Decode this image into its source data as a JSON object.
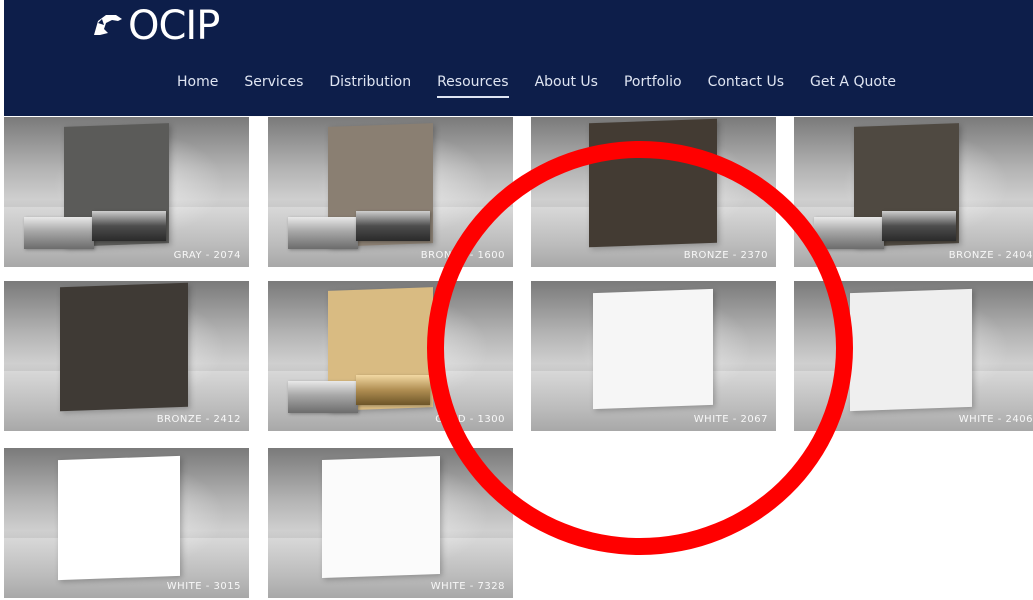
{
  "header": {
    "logo_text": "OCIP",
    "nav": [
      {
        "label": "Home"
      },
      {
        "label": "Services"
      },
      {
        "label": "Distribution"
      },
      {
        "label": "Resources",
        "active": true
      },
      {
        "label": "About Us"
      },
      {
        "label": "Portfolio"
      },
      {
        "label": "Contact Us"
      },
      {
        "label": "Get A Quote"
      }
    ]
  },
  "grid": {
    "tiles": [
      {
        "label": "GRAY - 2074",
        "color": "#5b5b59",
        "blocks": true
      },
      {
        "label": "BRONZE - 1600",
        "color": "#8a7f72",
        "blocks": true
      },
      {
        "label": "BRONZE - 2370",
        "color": "#433b33",
        "blocks": false
      },
      {
        "label": "BRONZE - 2404",
        "color": "#4f4941",
        "blocks": true
      },
      {
        "label": "BRONZE - 2412",
        "color": "#3f3a35",
        "blocks": false
      },
      {
        "label": "GOLD - 1300",
        "color": "#d9bb82",
        "blocks": true
      },
      {
        "label": "WHITE - 2067",
        "color": "#f6f6f6",
        "blocks": false
      },
      {
        "label": "WHITE - 2406",
        "color": "#efefef",
        "blocks": false
      },
      {
        "label": "WHITE - 3015",
        "color": "#ffffff",
        "blocks": false
      },
      {
        "label": "WHITE - 7328",
        "color": "#fbfbfb",
        "blocks": false
      }
    ]
  },
  "colors": {
    "header_bg": "#0d1e4a",
    "annotation_circle": "#ff0000"
  }
}
